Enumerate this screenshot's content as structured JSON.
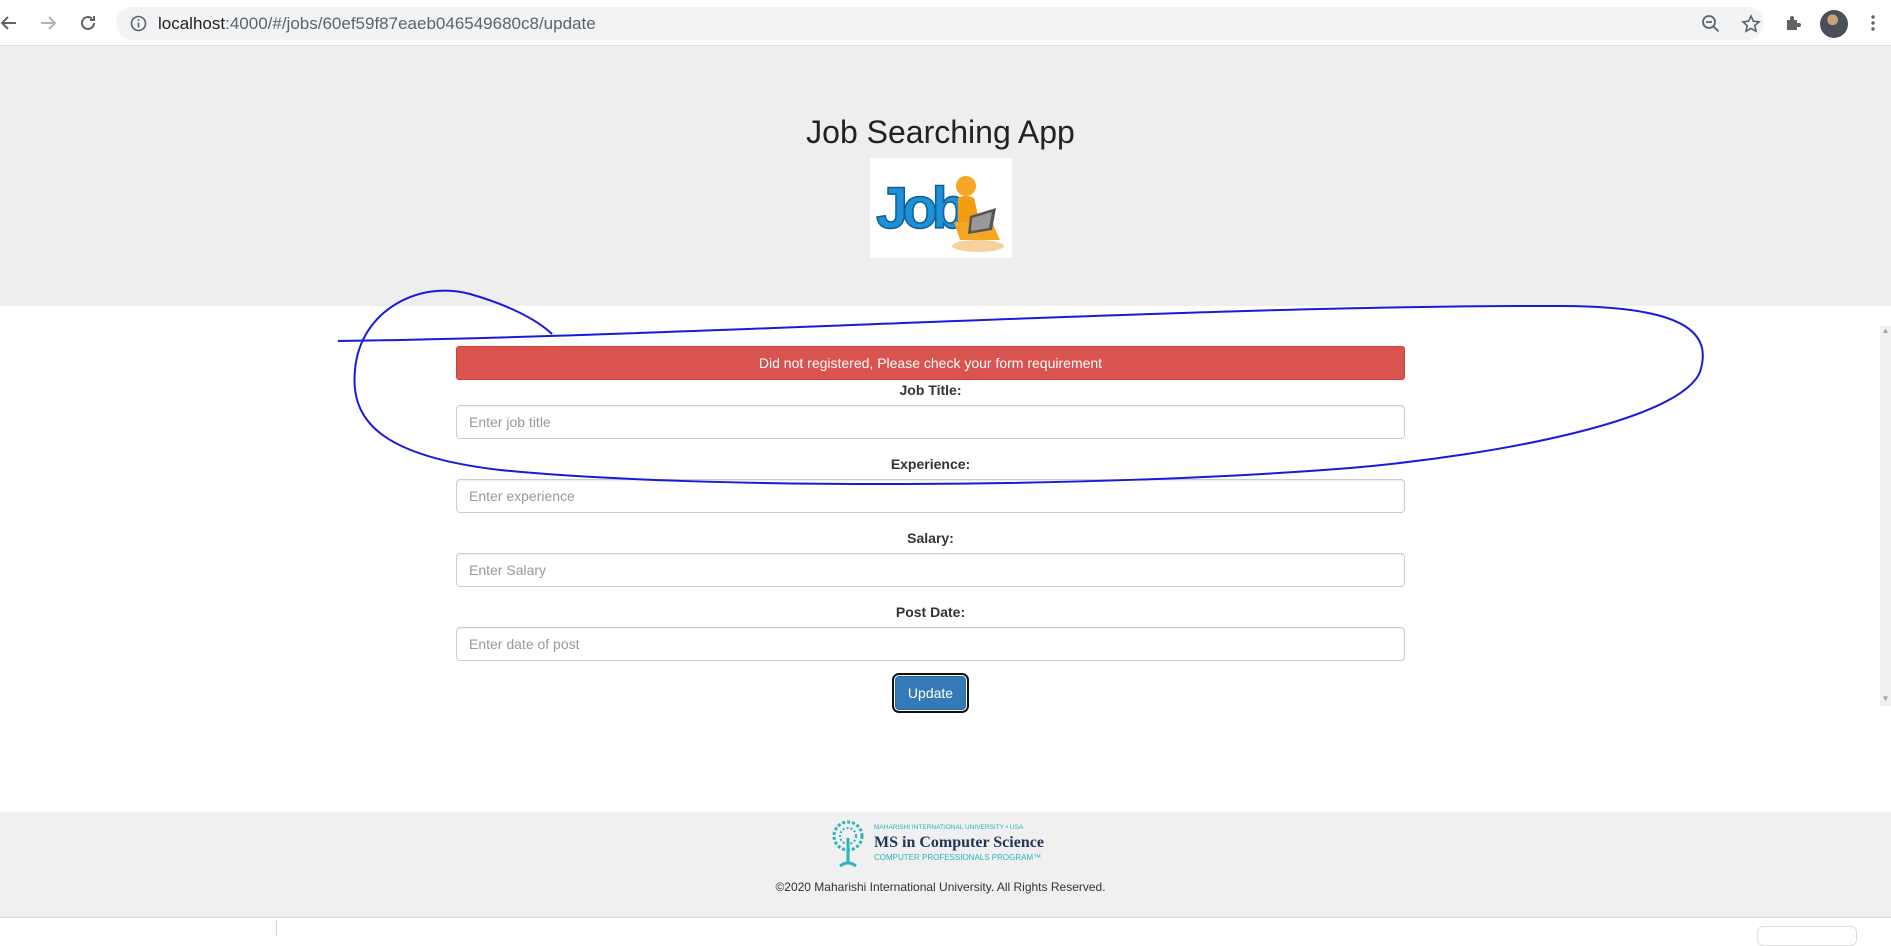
{
  "browser": {
    "url_host": "localhost",
    "url_rest": ":4000/#/jobs/60ef59f87eaeb046549680c8/update"
  },
  "header": {
    "title": "Job Searching App",
    "logo_text": "Job"
  },
  "form": {
    "alert": "Did not registered, Please check your form requirement",
    "fields": [
      {
        "label": "Job Title:",
        "placeholder": "Enter job title"
      },
      {
        "label": "Experience:",
        "placeholder": "Enter experience"
      },
      {
        "label": "Salary:",
        "placeholder": "Enter Salary"
      },
      {
        "label": "Post Date:",
        "placeholder": "Enter date of post"
      }
    ],
    "submit_label": "Update"
  },
  "footer": {
    "logo_small": "MAHARISHI INTERNATIONAL UNIVERSITY • USA",
    "logo_main": "MS in Computer Science",
    "logo_sub": "COMPUTER PROFESSIONALS PROGRAM™",
    "copyright": "©2020 Maharishi International University. All Rights Reserved."
  },
  "colors": {
    "alert_bg": "#d9534f",
    "button_bg": "#337ab7",
    "header_bg": "#eeeeee",
    "annotation": "#1a1adb",
    "miu_teal": "#2bb3c0"
  }
}
